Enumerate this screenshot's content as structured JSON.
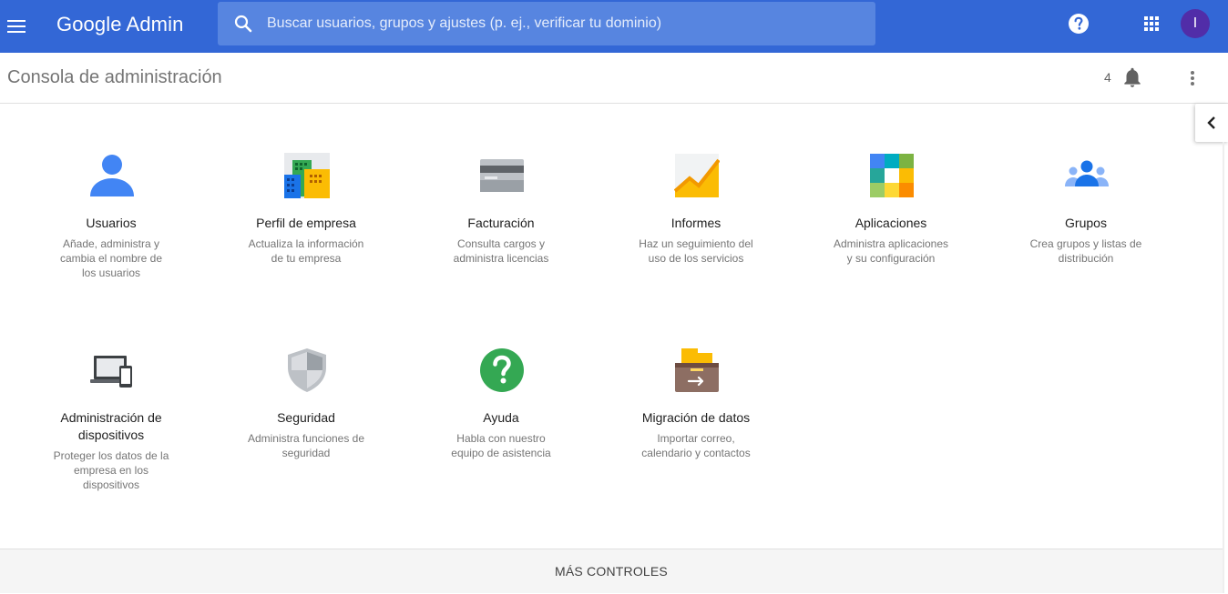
{
  "header": {
    "logo": {
      "google": "Google",
      "product": "Admin"
    },
    "search_placeholder": "Buscar usuarios, grupos y ajustes (p. ej., verificar tu dominio)",
    "avatar_initial": "I",
    "icons": [
      "menu-icon",
      "search-icon",
      "help-icon",
      "apps-grid-icon"
    ],
    "brand_color": "#3367d6"
  },
  "subheader": {
    "title": "Consola de administración",
    "notification_count": "4",
    "icons": [
      "bell-icon",
      "more-vert-icon"
    ]
  },
  "cards": [
    {
      "title": "Usuarios",
      "desc": [
        "Añade, administra y",
        "cambia el nombre de",
        "los usuarios"
      ],
      "icon": "user-icon"
    },
    {
      "title": "Perfil de empresa",
      "desc": [
        "Actualiza la información",
        "de tu empresa"
      ],
      "icon": "company-building-icon"
    },
    {
      "title": "Facturación",
      "desc": [
        "Consulta cargos y",
        "administra licencias"
      ],
      "icon": "credit-card-icon"
    },
    {
      "title": "Informes",
      "desc": [
        "Haz un seguimiento del",
        "uso de los servicios"
      ],
      "icon": "report-chart-icon"
    },
    {
      "title": "Aplicaciones",
      "desc": [
        "Administra aplicaciones",
        "y su configuración"
      ],
      "icon": "apps-icon"
    },
    {
      "title": "Grupos",
      "desc": [
        "Crea grupos y listas de",
        "distribución"
      ],
      "icon": "groups-icon"
    },
    {
      "title": [
        "Administración de",
        "dispositivos"
      ],
      "desc": [
        "Proteger los datos de la",
        "empresa en los",
        "dispositivos"
      ],
      "icon": "devices-icon"
    },
    {
      "title": "Seguridad",
      "desc": [
        "Administra funciones de",
        "seguridad"
      ],
      "icon": "shield-icon"
    },
    {
      "title": "Ayuda",
      "desc": [
        "Habla con nuestro",
        "equipo de asistencia"
      ],
      "icon": "help-circle-icon"
    },
    {
      "title": "Migración de datos",
      "desc": [
        "Importar correo,",
        "calendario y contactos"
      ],
      "icon": "data-migration-icon"
    }
  ],
  "footer": {
    "label": "MÁS CONTROLES"
  }
}
